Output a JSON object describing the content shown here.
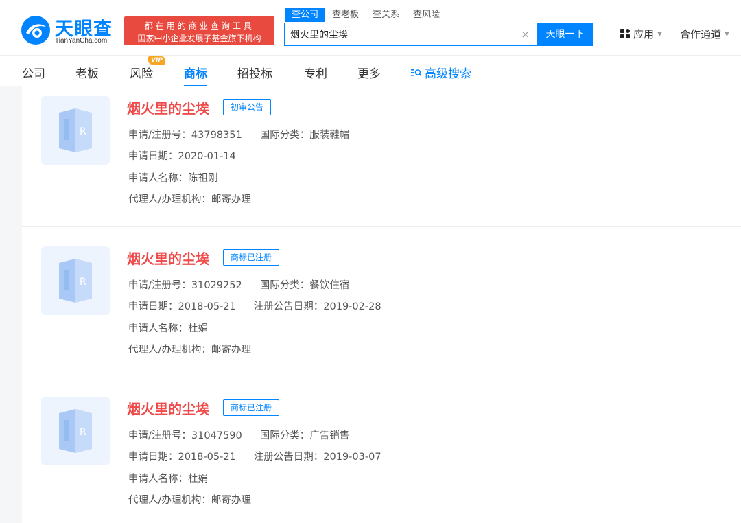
{
  "brand": {
    "name": "天眼查",
    "domain": "TianYanCha.com",
    "slogan_line1": "都在用的商业查询工具",
    "slogan_line2": "国家中小企业发展子基金旗下机构"
  },
  "search": {
    "tabs": [
      "查公司",
      "查老板",
      "查关系",
      "查风险"
    ],
    "query": "烟火里的尘埃",
    "button": "天眼一下",
    "clear": "×"
  },
  "header_right": {
    "apps": "应用",
    "partners": "合作通道"
  },
  "nav": {
    "items": [
      "公司",
      "老板",
      "风险",
      "商标",
      "招投标",
      "专利",
      "更多"
    ],
    "vip": "VIP",
    "active": "商标",
    "advanced": "高级搜索"
  },
  "results": [
    {
      "name": "烟火里的尘埃",
      "status": "初审公告",
      "reg_label": "申请/注册号：",
      "reg_no": "43798351",
      "class_label": "国际分类：",
      "class": "服装鞋帽",
      "date_label": "申请日期：",
      "date": "2020-01-14",
      "pub_label": "",
      "pub_date": "",
      "applicant_label": "申请人名称：",
      "applicant": "陈祖刚",
      "agent_label": "代理人/办理机构：",
      "agent": "邮寄办理"
    },
    {
      "name": "烟火里的尘埃",
      "status": "商标已注册",
      "reg_label": "申请/注册号：",
      "reg_no": "31029252",
      "class_label": "国际分类：",
      "class": "餐饮住宿",
      "date_label": "申请日期：",
      "date": "2018-05-21",
      "pub_label": "注册公告日期：",
      "pub_date": "2019-02-28",
      "applicant_label": "申请人名称：",
      "applicant": "杜娟",
      "agent_label": "代理人/办理机构：",
      "agent": "邮寄办理"
    },
    {
      "name": "烟火里的尘埃",
      "status": "商标已注册",
      "reg_label": "申请/注册号：",
      "reg_no": "31047590",
      "class_label": "国际分类：",
      "class": "广告销售",
      "date_label": "申请日期：",
      "date": "2018-05-21",
      "pub_label": "注册公告日期：",
      "pub_date": "2019-03-07",
      "applicant_label": "申请人名称：",
      "applicant": "杜娟",
      "agent_label": "代理人/办理机构：",
      "agent": "邮寄办理"
    }
  ],
  "colors": {
    "primary": "#0084ff",
    "brand_red": "#e94a3f",
    "title_red": "#f04949",
    "vip": "#f6a623"
  }
}
